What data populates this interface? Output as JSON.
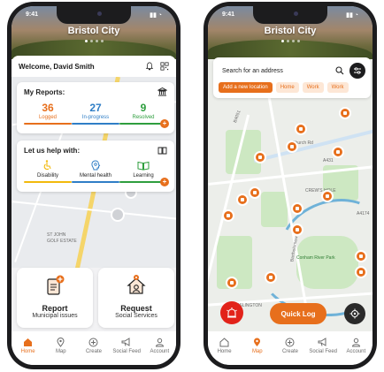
{
  "status_bar": {
    "time": "9:41"
  },
  "left": {
    "hero": {
      "title": "Bristol City"
    },
    "header": {
      "welcome": "Welcome, David Smith"
    },
    "reports_card": {
      "title": "My Reports:",
      "stats": [
        {
          "value": "36",
          "label": "Logged",
          "color": "#e76f1c"
        },
        {
          "value": "27",
          "label": "In-progress",
          "color": "#2f7ec6"
        },
        {
          "value": "9",
          "label": "Resolved",
          "color": "#2e9e3e"
        }
      ]
    },
    "help_card": {
      "title": "Let us help with:",
      "items": [
        {
          "label": "Disability",
          "icon": "wheelchair-icon",
          "color": "#f2b90c"
        },
        {
          "label": "Mental health",
          "icon": "brain-icon",
          "color": "#2f7ec6"
        },
        {
          "label": "Learning",
          "icon": "book-icon",
          "color": "#2e9e3e"
        }
      ]
    },
    "actions": [
      {
        "title": "Report",
        "subtitle": "Municipal issues",
        "icon": "report-icon"
      },
      {
        "title": "Request",
        "subtitle": "Social Services",
        "icon": "house-request-icon"
      }
    ],
    "map_labels": [
      "ST JOHN",
      "GOLF ESTATE"
    ]
  },
  "right": {
    "hero": {
      "title": "Bristol City"
    },
    "search": {
      "placeholder": "Search for an address"
    },
    "chips": [
      "Add a new location",
      "Home",
      "Work",
      "Work"
    ],
    "map_labels": {
      "road1": "B4051",
      "road2": "Church Rd",
      "road3": "Bartholomew Rd",
      "area1": "CREW'S HOLE",
      "area2": "Conham River Park",
      "area3": "ISLINGTON",
      "road4": "A431",
      "road5": "A4174"
    },
    "quick_log": "Quick Log"
  },
  "tabs": [
    {
      "label": "Home",
      "icon": "home-icon"
    },
    {
      "label": "Map",
      "icon": "map-pin-icon"
    },
    {
      "label": "Create",
      "icon": "plus-circle-icon"
    },
    {
      "label": "Social Feed",
      "icon": "megaphone-icon"
    },
    {
      "label": "Account",
      "icon": "user-icon"
    }
  ],
  "colors": {
    "accent": "#e76f1c",
    "emergency": "#e2231a"
  }
}
